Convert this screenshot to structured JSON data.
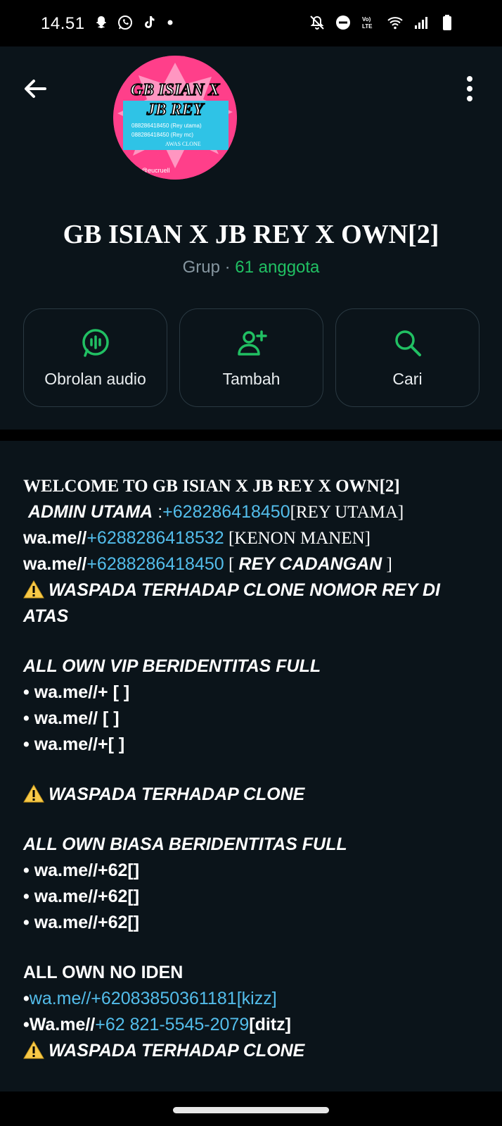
{
  "status_bar": {
    "time": "14.51",
    "left_icons": [
      "snapchat-icon",
      "whatsapp-icon",
      "tiktok-icon",
      "dot-icon"
    ],
    "right_icons": [
      "mute-icon",
      "dnd-icon",
      "volte-icon",
      "wifi-icon",
      "signal-icon",
      "battery-icon"
    ]
  },
  "header": {
    "group_name": "GB ISIAN X JB REY X OWN[2]",
    "type_label": "Grup",
    "separator": " · ",
    "member_count": "61 anggota",
    "avatar_title_line1": "GB ISIAN X",
    "avatar_title_line2": "JB REY",
    "avatar_phone1": "088286418450 (Rey utama)",
    "avatar_phone2": "088286418450 (Rey mc)",
    "avatar_warning": "AWAS CLONE",
    "avatar_credit": "@eucruell"
  },
  "actions": [
    {
      "label": "Obrolan audio",
      "icon": "audio-chat-icon"
    },
    {
      "label": "Tambah",
      "icon": "add-member-icon"
    },
    {
      "label": "Cari",
      "icon": "search-icon"
    }
  ],
  "description": {
    "l1": "WELCOME TO GB ISIAN X JB REY X OWN[2]",
    "l2_a": "ADMIN UTAMA",
    "l2_b": " :",
    "l2_link": "+628286418450",
    "l2_c": "[REY UTAMA]",
    "l3_a": "wa.me//",
    "l3_link": "+6288286418532",
    "l3_c": " [KENON MANEN]",
    "l4_a": "wa.me//",
    "l4_link": "+6288286418450",
    "l4_c1": " [ ",
    "l4_c2": "REY CADANGAN",
    "l4_c3": " ]",
    "l5": "WASPADA TERHADAP CLONE NOMOR REY DI ATAS",
    "vip_heading": "ALL OWN VIP BERIDENTITAS FULL",
    "vip_items": [
      "• wa.me//+ [  ]",
      "• wa.me// [ ]",
      "• wa.me//+[  ]"
    ],
    "warn2": "WASPADA TERHADAP CLONE",
    "biasa_heading": "ALL OWN BIASA BERIDENTITAS FULL",
    "biasa_items": [
      "• wa.me//+62[]",
      "• wa.me//+62[]",
      "• wa.me//+62[]"
    ],
    "noiden_heading": "ALL OWN NO IDEN",
    "noiden1_prefix": "•",
    "noiden1_link": "wa.me//+62083850361181[kizz]",
    "noiden2_prefix": "•Wa.me//",
    "noiden2_link": "+62 821-5545-2079",
    "noiden2_suffix": "[ditz]",
    "warn3": "WASPADA TERHADAP CLONE"
  },
  "colors": {
    "background": "#0b141a",
    "accent_green": "#21c063",
    "link_blue": "#53bdeb",
    "muted": "#8696a0"
  }
}
